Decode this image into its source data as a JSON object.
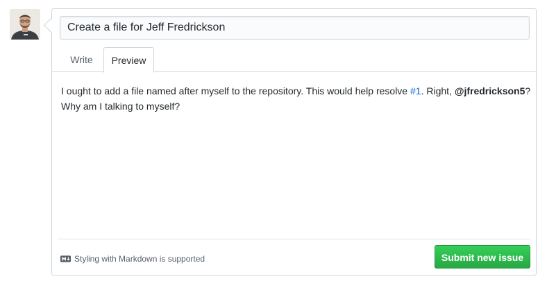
{
  "user": {
    "avatar_icon": "user-avatar"
  },
  "issue": {
    "title_value": "Create a file for Jeff Fredrickson",
    "tabs": [
      {
        "label": "Write",
        "selected": false
      },
      {
        "label": "Preview",
        "selected": true
      }
    ],
    "preview": {
      "text_before_link": "I ought to add a file named after myself to the repository. This would help resolve ",
      "issue_link": "#1",
      "text_after_link": ". Right, ",
      "mention": "@jfredrickson5",
      "text_end": "?",
      "line2": "Why am I talking to myself?"
    },
    "markdown_note": "Styling with Markdown is supported",
    "markdown_icon": "markdown-icon",
    "submit_label": "Submit new issue"
  },
  "colors": {
    "link": "#0366d6",
    "submit_top": "#34d058",
    "submit_bottom": "#28a745",
    "border": "#d1d5da"
  }
}
